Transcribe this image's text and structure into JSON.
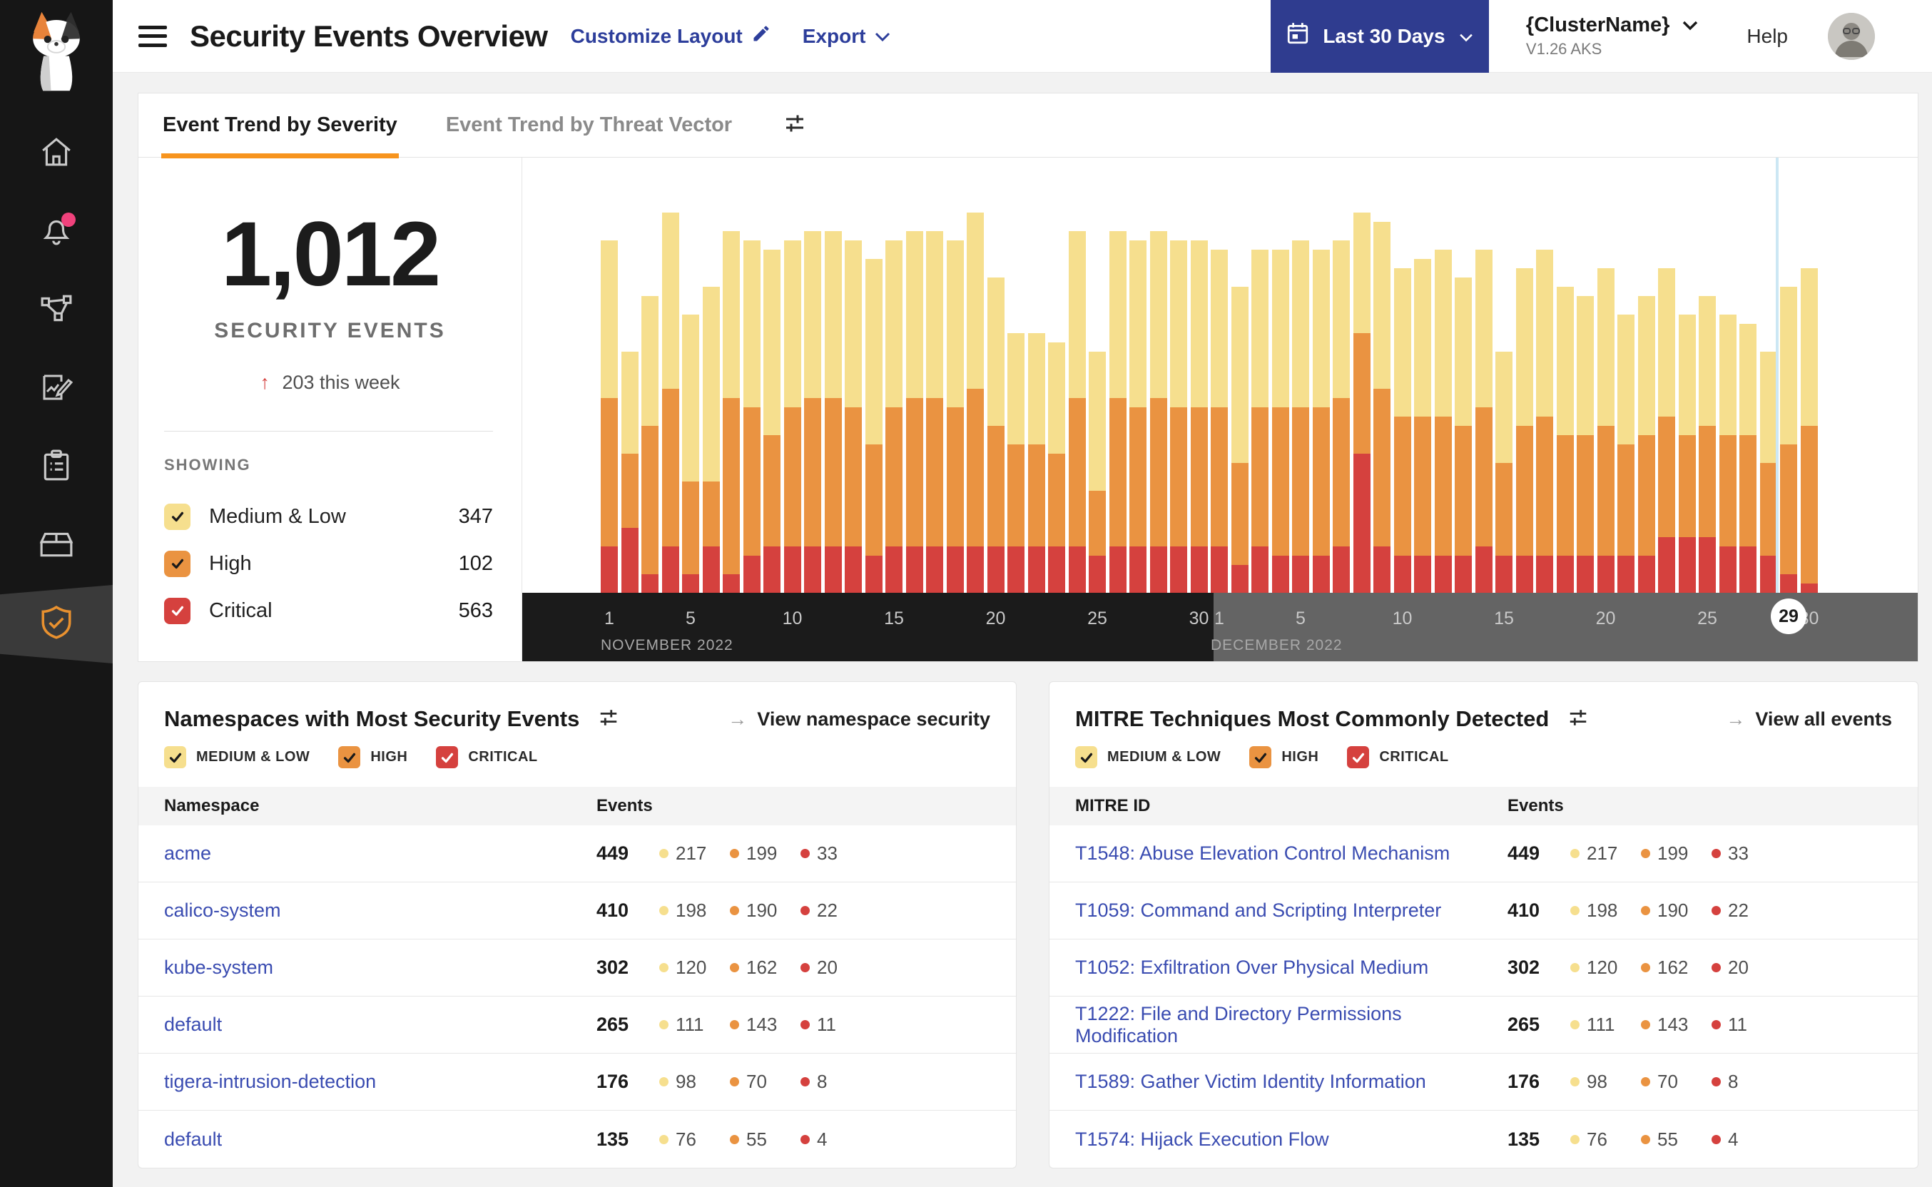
{
  "ui": {
    "arrow_right": "→",
    "delta_arrow": "↑"
  },
  "header": {
    "title": "Security Events Overview",
    "customize_layout": "Customize Layout",
    "export_label": "Export",
    "date_range": "Last 30 Days",
    "cluster_name": "{ClusterName}",
    "cluster_version": "V1.26 AKS",
    "help": "Help"
  },
  "sidebar": {
    "icons": [
      "calico-logo",
      "home",
      "notifications",
      "service-graph",
      "edit-report",
      "compliance-clipboard",
      "workloads-box",
      "security-shield"
    ],
    "active_icon": "security-shield",
    "notification_dot_color": "#F0427C"
  },
  "tabs": {
    "items": [
      {
        "label": "Event Trend by Severity",
        "active": true
      },
      {
        "label": "Event Trend by Threat Vector",
        "active": false
      }
    ]
  },
  "stats": {
    "total": "1,012",
    "total_label": "SECURITY EVENTS",
    "delta": "203 this week",
    "showing_label": "SHOWING",
    "severities": [
      {
        "key": "medium_low",
        "label": "Medium & Low",
        "count": "347",
        "color": "#F6DF8E",
        "check": "#1A1A1A"
      },
      {
        "key": "high",
        "label": "High",
        "count": "102",
        "color": "#EA9341",
        "check": "#1A1A1A"
      },
      {
        "key": "critical",
        "label": "Critical",
        "count": "563",
        "color": "#D5413E",
        "check": "#FFFFFF"
      }
    ]
  },
  "chart_data": {
    "type": "bar",
    "stacked": true,
    "title": "Event Trend by Severity",
    "unit": "security events per day (estimated from bar heights, no y-axis shown)",
    "x": {
      "months": [
        {
          "label": "NOVEMBER 2022",
          "days": 30,
          "ticks": [
            1,
            5,
            10,
            15,
            20,
            25,
            30
          ]
        },
        {
          "label": "DECEMBER 2022",
          "days": 30,
          "ticks": [
            1,
            5,
            10,
            15,
            20,
            25,
            30
          ]
        }
      ]
    },
    "highlight": {
      "month_index": 1,
      "day": 29
    },
    "grid": false,
    "legend_position": "left panel checkboxes",
    "series": [
      {
        "name": "Critical",
        "color": "#D5413E",
        "values": [
          5,
          7,
          2,
          5,
          2,
          5,
          2,
          4,
          5,
          5,
          5,
          5,
          5,
          4,
          5,
          5,
          5,
          5,
          5,
          5,
          5,
          5,
          5,
          5,
          4,
          5,
          5,
          5,
          5,
          5,
          5,
          3,
          5,
          4,
          4,
          4,
          5,
          15,
          5,
          4,
          4,
          4,
          4,
          5,
          4,
          4,
          4,
          4,
          4,
          4,
          4,
          4,
          6,
          6,
          6,
          5,
          5,
          4,
          2,
          1
        ]
      },
      {
        "name": "High",
        "color": "#EA9341",
        "values": [
          16,
          8,
          16,
          17,
          10,
          7,
          19,
          16,
          12,
          15,
          16,
          16,
          15,
          12,
          15,
          16,
          16,
          15,
          17,
          13,
          11,
          11,
          10,
          16,
          7,
          16,
          15,
          16,
          15,
          15,
          15,
          11,
          15,
          16,
          16,
          16,
          16,
          13,
          17,
          15,
          15,
          15,
          14,
          15,
          10,
          14,
          15,
          13,
          13,
          14,
          12,
          13,
          13,
          11,
          12,
          12,
          12,
          10,
          14,
          17
        ]
      },
      {
        "name": "Medium & Low",
        "color": "#F6DF8E",
        "values": [
          17,
          11,
          14,
          19,
          18,
          21,
          18,
          18,
          20,
          18,
          18,
          18,
          18,
          20,
          18,
          18,
          18,
          18,
          19,
          16,
          12,
          12,
          12,
          18,
          15,
          18,
          18,
          18,
          18,
          18,
          17,
          19,
          17,
          17,
          18,
          17,
          17,
          13,
          18,
          16,
          17,
          18,
          16,
          17,
          12,
          17,
          18,
          16,
          15,
          17,
          14,
          15,
          16,
          13,
          14,
          13,
          12,
          12,
          17,
          17
        ]
      }
    ]
  },
  "namespaces_card": {
    "title": "Namespaces with Most Security Events",
    "action_label": "View namespace security",
    "columns": [
      "Namespace",
      "Events"
    ],
    "filters": [
      {
        "label": "MEDIUM & LOW",
        "color": "#F6DF8E",
        "check": "#1A1A1A"
      },
      {
        "label": "HIGH",
        "color": "#EA9341",
        "check": "#1A1A1A"
      },
      {
        "label": "CRITICAL",
        "color": "#D5413E",
        "check": "#FFFFFF"
      }
    ],
    "rows": [
      {
        "name": "acme",
        "total": "449",
        "medium_low": "217",
        "high": "199",
        "critical": "33"
      },
      {
        "name": "calico-system",
        "total": "410",
        "medium_low": "198",
        "high": "190",
        "critical": "22"
      },
      {
        "name": "kube-system",
        "total": "302",
        "medium_low": "120",
        "high": "162",
        "critical": "20"
      },
      {
        "name": "default",
        "total": "265",
        "medium_low": "111",
        "high": "143",
        "critical": "11"
      },
      {
        "name": "tigera-intrusion-detection",
        "total": "176",
        "medium_low": "98",
        "high": "70",
        "critical": "8"
      },
      {
        "name": "default",
        "total": "135",
        "medium_low": "76",
        "high": "55",
        "critical": "4"
      }
    ]
  },
  "mitre_card": {
    "title": "MITRE Techniques Most Commonly Detected",
    "action_label": "View all events",
    "columns": [
      "MITRE ID",
      "Events"
    ],
    "filters": [
      {
        "label": "MEDIUM & LOW",
        "color": "#F6DF8E",
        "check": "#1A1A1A"
      },
      {
        "label": "HIGH",
        "color": "#EA9341",
        "check": "#1A1A1A"
      },
      {
        "label": "CRITICAL",
        "color": "#D5413E",
        "check": "#FFFFFF"
      }
    ],
    "rows": [
      {
        "name": "T1548: Abuse Elevation Control Mechanism",
        "total": "449",
        "medium_low": "217",
        "high": "199",
        "critical": "33"
      },
      {
        "name": "T1059: Command and Scripting Interpreter",
        "total": "410",
        "medium_low": "198",
        "high": "190",
        "critical": "22"
      },
      {
        "name": "T1052: Exfiltration Over Physical Medium",
        "total": "302",
        "medium_low": "120",
        "high": "162",
        "critical": "20"
      },
      {
        "name": "T1222: File and Directory Permissions Modification",
        "total": "265",
        "medium_low": "111",
        "high": "143",
        "critical": "11"
      },
      {
        "name": "T1589: Gather Victim Identity Information",
        "total": "176",
        "medium_low": "98",
        "high": "70",
        "critical": "8"
      },
      {
        "name": "T1574: Hijack Execution Flow",
        "total": "135",
        "medium_low": "76",
        "high": "55",
        "critical": "4"
      }
    ]
  },
  "colors": {
    "medium_low": "#F6DF8E",
    "high": "#EA9341",
    "critical": "#D5413E",
    "accent_orange": "#F7941E",
    "link_blue": "#3A4CB1",
    "button_blue": "#2F3C8F",
    "november_band": "#1B1B1B",
    "december_band": "#646464",
    "current_day_line": "#CCE7F4",
    "notification_pink": "#F0427C"
  }
}
